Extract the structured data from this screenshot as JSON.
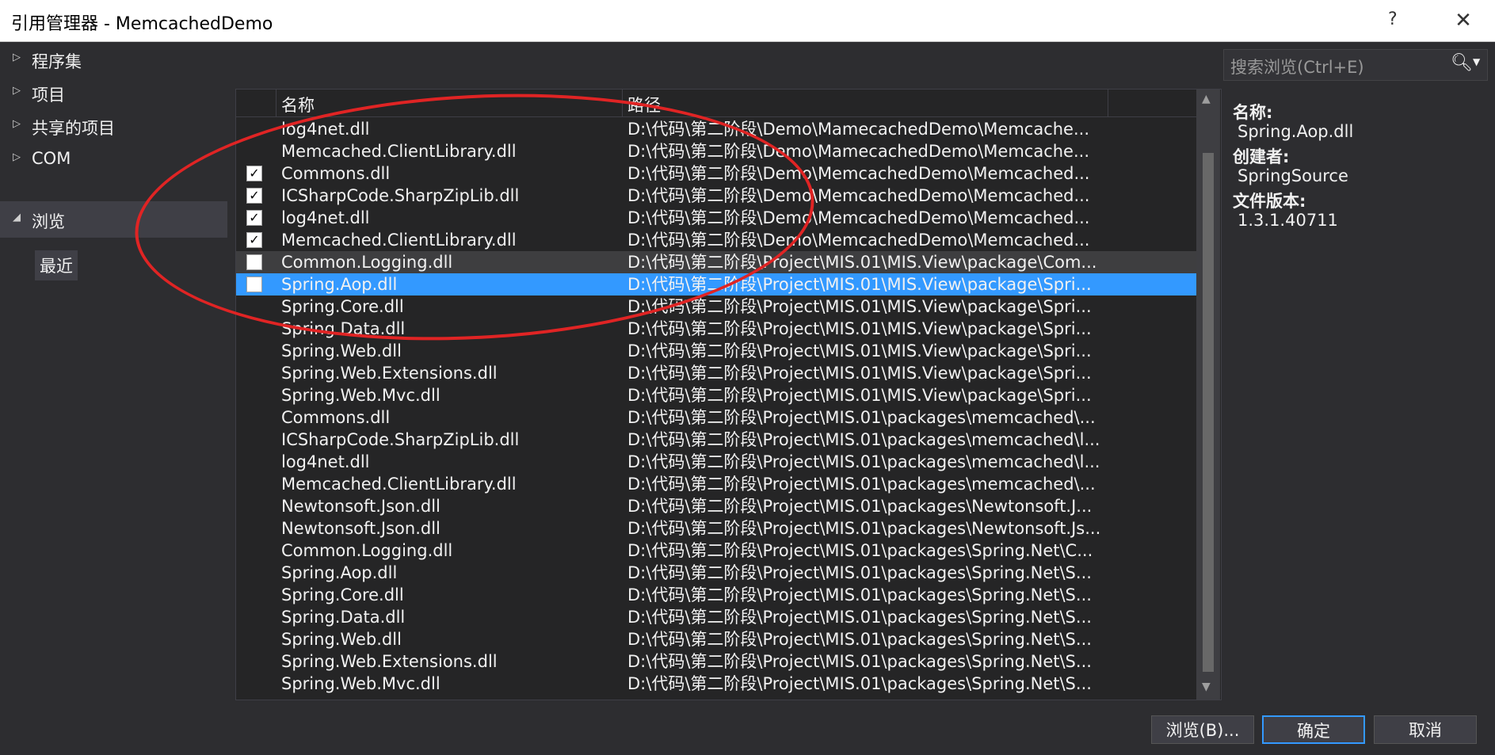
{
  "window": {
    "title": "引用管理器 - MemcachedDemo",
    "help_label": "?",
    "close_label": "✕"
  },
  "nav": {
    "items": [
      {
        "arrow": "▷",
        "label": "程序集"
      },
      {
        "arrow": "▷",
        "label": "项目"
      },
      {
        "arrow": "▷",
        "label": "共享的项目"
      },
      {
        "arrow": "▷",
        "label": "COM"
      },
      {
        "arrow": "◢",
        "label": "浏览"
      }
    ],
    "sub_item": "最近"
  },
  "search": {
    "placeholder": "搜索浏览(Ctrl+E)",
    "icon": "search-icon"
  },
  "list": {
    "columns": [
      "名称",
      "路径"
    ],
    "rows": [
      {
        "checkbox": "none",
        "name": "log4net.dll",
        "path": "D:\\代码\\第二阶段\\Demo\\MamecachedDemo\\Memcache..."
      },
      {
        "checkbox": "none",
        "name": "Memcached.ClientLibrary.dll",
        "path": "D:\\代码\\第二阶段\\Demo\\MamecachedDemo\\Memcache..."
      },
      {
        "checkbox": "checked",
        "name": "Commons.dll",
        "path": "D:\\代码\\第二阶段\\Demo\\MemcachedDemo\\Memcached..."
      },
      {
        "checkbox": "checked",
        "name": "ICSharpCode.SharpZipLib.dll",
        "path": "D:\\代码\\第二阶段\\Demo\\MemcachedDemo\\Memcached..."
      },
      {
        "checkbox": "checked",
        "name": "log4net.dll",
        "path": "D:\\代码\\第二阶段\\Demo\\MemcachedDemo\\Memcached..."
      },
      {
        "checkbox": "checked",
        "name": "Memcached.ClientLibrary.dll",
        "path": "D:\\代码\\第二阶段\\Demo\\MemcachedDemo\\Memcached..."
      },
      {
        "checkbox": "unchecked",
        "name": "Common.Logging.dll",
        "path": "D:\\代码\\第二阶段\\Project\\MIS.01\\MIS.View\\package\\Com...",
        "state": "hover"
      },
      {
        "checkbox": "unchecked",
        "name": "Spring.Aop.dll",
        "path": "D:\\代码\\第二阶段\\Project\\MIS.01\\MIS.View\\package\\Spri...",
        "state": "selected"
      },
      {
        "checkbox": "none",
        "name": "Spring.Core.dll",
        "path": "D:\\代码\\第二阶段\\Project\\MIS.01\\MIS.View\\package\\Spri..."
      },
      {
        "checkbox": "none",
        "name": "Spring.Data.dll",
        "path": "D:\\代码\\第二阶段\\Project\\MIS.01\\MIS.View\\package\\Spri..."
      },
      {
        "checkbox": "none",
        "name": "Spring.Web.dll",
        "path": "D:\\代码\\第二阶段\\Project\\MIS.01\\MIS.View\\package\\Spri..."
      },
      {
        "checkbox": "none",
        "name": "Spring.Web.Extensions.dll",
        "path": "D:\\代码\\第二阶段\\Project\\MIS.01\\MIS.View\\package\\Spri..."
      },
      {
        "checkbox": "none",
        "name": "Spring.Web.Mvc.dll",
        "path": "D:\\代码\\第二阶段\\Project\\MIS.01\\MIS.View\\package\\Spri..."
      },
      {
        "checkbox": "none",
        "name": "Commons.dll",
        "path": "D:\\代码\\第二阶段\\Project\\MIS.01\\packages\\memcached\\..."
      },
      {
        "checkbox": "none",
        "name": "ICSharpCode.SharpZipLib.dll",
        "path": "D:\\代码\\第二阶段\\Project\\MIS.01\\packages\\memcached\\l..."
      },
      {
        "checkbox": "none",
        "name": "log4net.dll",
        "path": "D:\\代码\\第二阶段\\Project\\MIS.01\\packages\\memcached\\l..."
      },
      {
        "checkbox": "none",
        "name": "Memcached.ClientLibrary.dll",
        "path": "D:\\代码\\第二阶段\\Project\\MIS.01\\packages\\memcached\\..."
      },
      {
        "checkbox": "none",
        "name": "Newtonsoft.Json.dll",
        "path": "D:\\代码\\第二阶段\\Project\\MIS.01\\packages\\Newtonsoft.J..."
      },
      {
        "checkbox": "none",
        "name": "Newtonsoft.Json.dll",
        "path": "D:\\代码\\第二阶段\\Project\\MIS.01\\packages\\Newtonsoft.Js..."
      },
      {
        "checkbox": "none",
        "name": "Common.Logging.dll",
        "path": "D:\\代码\\第二阶段\\Project\\MIS.01\\packages\\Spring.Net\\C..."
      },
      {
        "checkbox": "none",
        "name": "Spring.Aop.dll",
        "path": "D:\\代码\\第二阶段\\Project\\MIS.01\\packages\\Spring.Net\\S..."
      },
      {
        "checkbox": "none",
        "name": "Spring.Core.dll",
        "path": "D:\\代码\\第二阶段\\Project\\MIS.01\\packages\\Spring.Net\\S..."
      },
      {
        "checkbox": "none",
        "name": "Spring.Data.dll",
        "path": "D:\\代码\\第二阶段\\Project\\MIS.01\\packages\\Spring.Net\\S..."
      },
      {
        "checkbox": "none",
        "name": "Spring.Web.dll",
        "path": "D:\\代码\\第二阶段\\Project\\MIS.01\\packages\\Spring.Net\\S..."
      },
      {
        "checkbox": "none",
        "name": "Spring.Web.Extensions.dll",
        "path": "D:\\代码\\第二阶段\\Project\\MIS.01\\packages\\Spring.Net\\S..."
      },
      {
        "checkbox": "none",
        "name": "Spring.Web.Mvc.dll",
        "path": "D:\\代码\\第二阶段\\Project\\MIS.01\\packages\\Spring.Net\\S..."
      }
    ]
  },
  "details": {
    "name_label": "名称:",
    "name_value": "Spring.Aop.dll",
    "creator_label": "创建者:",
    "creator_value": "SpringSource",
    "version_label": "文件版本:",
    "version_value": "1.3.1.40711"
  },
  "buttons": {
    "browse": "浏览(B)...",
    "ok": "确定",
    "cancel": "取消"
  },
  "colors": {
    "background": "#2d2d30",
    "selection": "#3399ff",
    "annotation": "#e02424"
  }
}
